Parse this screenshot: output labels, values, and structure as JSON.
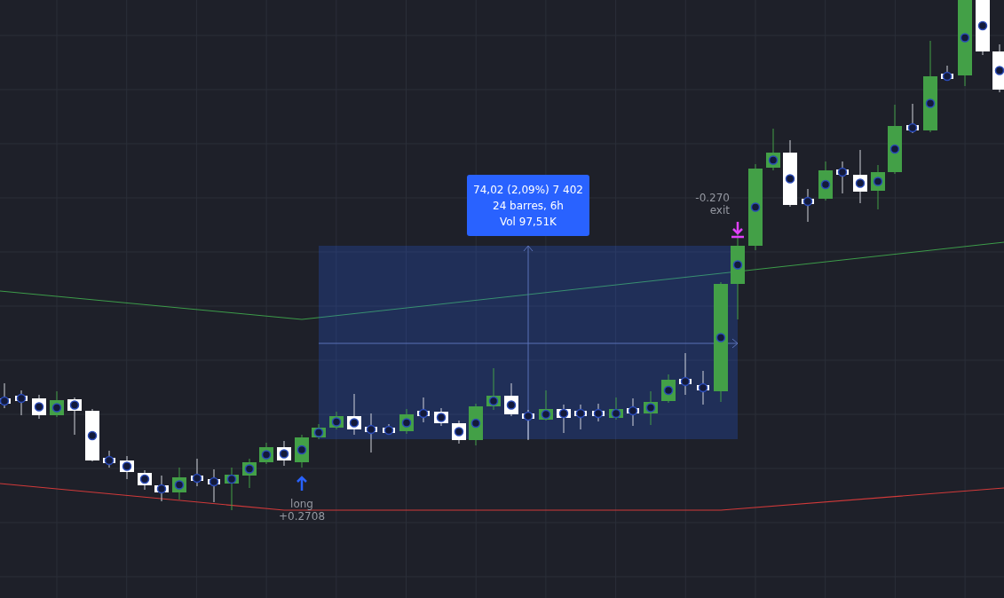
{
  "range_tooltip": {
    "lines": [
      "74,02 (2,09%) 7 402",
      "24 barres, 6h",
      "Vol 97,51K"
    ]
  },
  "trade_markers": [
    {
      "kind": "entry",
      "label": "long",
      "value": "+0.2708"
    },
    {
      "kind": "exit",
      "label": "exit",
      "value": "-0.270"
    }
  ]
}
